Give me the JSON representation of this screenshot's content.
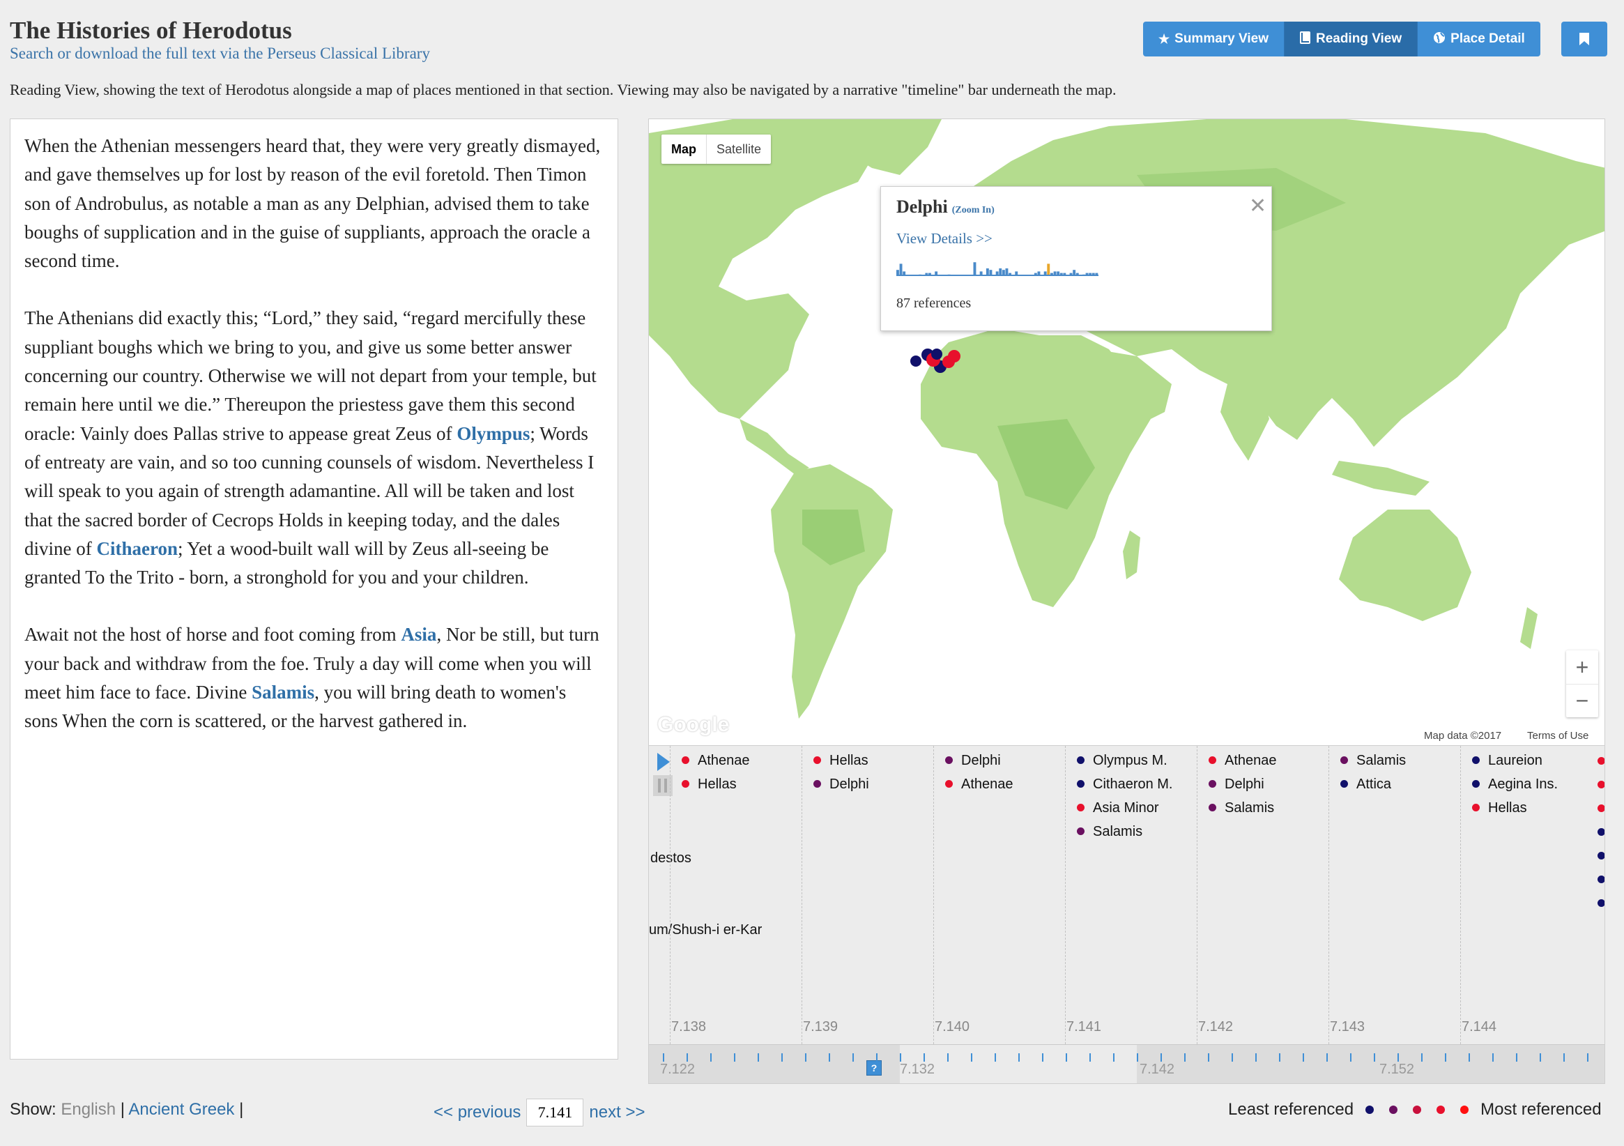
{
  "header": {
    "title": "The Histories of Herodotus",
    "subtitle": "Search or download the full text via the Perseus Classical Library",
    "intro": "Reading View, showing the text of Herodotus alongside a map of places mentioned in that section. Viewing may also be navigated by a narrative \"timeline\" bar underneath the map."
  },
  "views": {
    "summary": "Summary View",
    "reading": "Reading View",
    "place": "Place Detail",
    "active": "reading"
  },
  "text": {
    "p1": "When the Athenian messengers heard that, they were very greatly dismayed, and gave themselves up for lost by reason of the evil foretold. Then Timon son of Androbulus, as notable a man as any Delphian, advised them to take boughs of supplication and in the guise of suppliants, approach the oracle a second time.",
    "p2a": "The Athenians did exactly this; “Lord,” they said, “regard mercifully these suppliant boughs which we bring to you, and give us some better answer concerning our country. Otherwise we will not depart from your temple, but remain here until we die.” Thereupon the priestess gave them this second oracle: Vainly does Pallas strive to appease great Zeus of ",
    "p2_place1": "Olympus",
    "p2b": "; Words of entreaty are vain, and so too cunning counsels of wisdom. Nevertheless I will speak to you again of strength adamantine. All will be taken and lost that the sacred border of Cecrops Holds in keeping today, and the dales divine of ",
    "p2_place2": "Cithaeron",
    "p2c": "; Yet a wood-built wall will by Zeus all-seeing be granted To the Trito - born, a stronghold for you and your children.",
    "p3a": "Await not the host of horse and foot coming from ",
    "p3_place1": "Asia",
    "p3b": ", Nor be still, but turn your back and withdraw from the foe. Truly a day will come when you will meet him face to face. Divine ",
    "p3_place2": "Salamis",
    "p3c": ", you will bring death to women's sons When the corn is scattered, or the harvest gathered in."
  },
  "map": {
    "type_map": "Map",
    "type_satellite": "Satellite",
    "active_type": "Map",
    "popup": {
      "title": "Delphi",
      "zoom_link": "(Zoom In)",
      "details_link": "View Details >>",
      "references": "87 references",
      "histogram": [
        0.4,
        0.8,
        0.3,
        0,
        0,
        0,
        0,
        0.1,
        0,
        0.2,
        0.2,
        0,
        0.3,
        0,
        0,
        0,
        0.1,
        0,
        0,
        0,
        0,
        0,
        0,
        0,
        0.9,
        0,
        0.3,
        0,
        0.5,
        0.4,
        0,
        0.3,
        0.5,
        0.4,
        0.5,
        0.2,
        0,
        0.3,
        0,
        0,
        0,
        0,
        0,
        0.2,
        0.3,
        0,
        0.3,
        0.8,
        0.2,
        0.3,
        0.3,
        0.2,
        0.2,
        0,
        0.2,
        0.4,
        0.2,
        0,
        0.1,
        0.2,
        0.2,
        0.2,
        0.2
      ],
      "highlight_index": 47
    },
    "zoom_in": "+",
    "zoom_out": "−",
    "attribution": "Map data ©2017",
    "terms": "Terms of Use",
    "logo": "Google",
    "colors": {
      "land": "#b4dc8e",
      "land_dark": "#8fc86b",
      "water": "#ffffff",
      "popup_bar": "#4a8ac9",
      "popup_highlight": "#e8a62a"
    }
  },
  "timeline": {
    "ticks": [
      "7.138",
      "7.139",
      "7.140",
      "7.141",
      "7.142",
      "7.143",
      "7.144"
    ],
    "columns": [
      [
        {
          "name": "Athenae",
          "color": "#e8102c"
        },
        {
          "name": "Hellas",
          "color": "#e8102c"
        }
      ],
      [
        {
          "name": "Hellas",
          "color": "#e8102c"
        },
        {
          "name": "Delphi",
          "color": "#6a1060"
        }
      ],
      [
        {
          "name": "Delphi",
          "color": "#6a1060"
        },
        {
          "name": "Athenae",
          "color": "#e8102c"
        }
      ],
      [
        {
          "name": "Olympus M.",
          "color": "#10106a"
        },
        {
          "name": "Cithaeron M.",
          "color": "#10106a"
        },
        {
          "name": "Asia Minor",
          "color": "#e8102c"
        },
        {
          "name": "Salamis",
          "color": "#6a1060"
        }
      ],
      [
        {
          "name": "Athenae",
          "color": "#e8102c"
        },
        {
          "name": "Delphi",
          "color": "#6a1060"
        },
        {
          "name": "Salamis",
          "color": "#6a1060"
        }
      ],
      [
        {
          "name": "Salamis",
          "color": "#6a1060"
        },
        {
          "name": "Attica",
          "color": "#10106a"
        }
      ],
      [
        {
          "name": "Laureion",
          "color": "#10106a"
        },
        {
          "name": "Aegina Ins.",
          "color": "#10106a"
        },
        {
          "name": "Hellas",
          "color": "#e8102c"
        }
      ]
    ],
    "overflow_left_1": "destos",
    "overflow_left_2": "um/Shush-i er-Kar",
    "edge_dots": [
      "#e8102c",
      "#e8102c",
      "#e8102c",
      "#10106a",
      "#10106a",
      "#10106a",
      "#10106a"
    ],
    "scrub_labels": [
      "7.122",
      "7.132",
      "7.142",
      "7.152"
    ],
    "help": "?"
  },
  "footer": {
    "show_label": "Show:",
    "lang_english": "English",
    "lang_greek": "Ancient Greek",
    "sep": "|",
    "prev": "<< previous",
    "next": "next >>",
    "page_value": "7.141",
    "least": "Least referenced",
    "most": "Most referenced",
    "legend_colors": [
      "#10106a",
      "#6a1060",
      "#c8103c",
      "#e8102c",
      "#ff1010"
    ]
  }
}
